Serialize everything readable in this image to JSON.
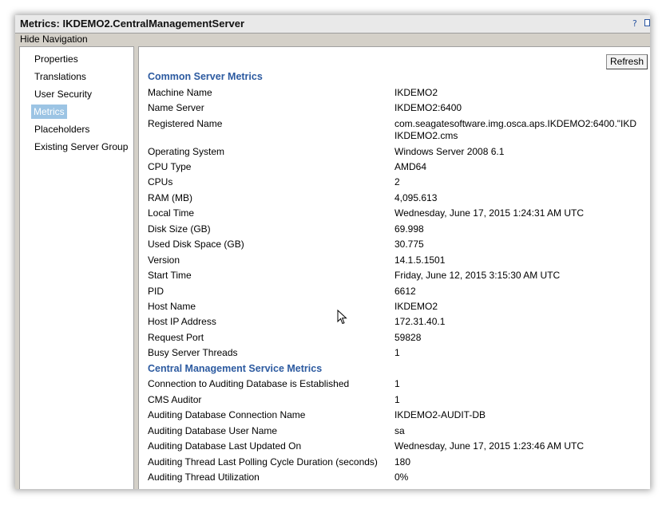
{
  "window": {
    "title": "Metrics: IKDEMO2.CentralManagementServer",
    "help_glyph": "?",
    "hide_navigation": "Hide Navigation"
  },
  "nav": {
    "items": [
      {
        "label": "Properties"
      },
      {
        "label": "Translations"
      },
      {
        "label": "User Security"
      },
      {
        "label": "Metrics",
        "selected": true
      },
      {
        "label": "Placeholders"
      },
      {
        "label": "Existing Server Group"
      }
    ]
  },
  "toolbar": {
    "refresh_label": "Refresh"
  },
  "common": {
    "title": "Common Server Metrics",
    "rows": [
      {
        "key": "Machine Name",
        "value": "IKDEMO2"
      },
      {
        "key": "Name Server",
        "value": "IKDEMO2:6400"
      },
      {
        "key": "Registered Name",
        "value": "com.seagatesoftware.img.osca.aps.IKDEMO2:6400.\"IKD",
        "value2": "IKDEMO2.cms"
      },
      {
        "key": "Operating System",
        "value": "Windows Server 2008 6.1"
      },
      {
        "key": "CPU Type",
        "value": "AMD64"
      },
      {
        "key": "CPUs",
        "value": "2"
      },
      {
        "key": "RAM (MB)",
        "value": "4,095.613"
      },
      {
        "key": "Local Time",
        "value": "Wednesday, June 17, 2015 1:24:31 AM UTC"
      },
      {
        "key": "Disk Size (GB)",
        "value": "69.998"
      },
      {
        "key": "Used Disk Space (GB)",
        "value": "30.775"
      },
      {
        "key": "Version",
        "value": "14.1.5.1501"
      },
      {
        "key": "Start Time",
        "value": "Friday, June 12, 2015 3:15:30 AM UTC"
      },
      {
        "key": "PID",
        "value": "6612"
      },
      {
        "key": "Host Name",
        "value": "IKDEMO2"
      },
      {
        "key": "Host IP Address",
        "value": "172.31.40.1"
      },
      {
        "key": "Request Port",
        "value": "59828"
      },
      {
        "key": "Busy Server Threads",
        "value": "1"
      }
    ]
  },
  "cms": {
    "title": "Central Management Service Metrics",
    "rows": [
      {
        "key": "Connection to Auditing Database is Established",
        "value": "1"
      },
      {
        "key": "CMS Auditor",
        "value": "1"
      },
      {
        "key": "Auditing Database Connection Name",
        "value": "IKDEMO2-AUDIT-DB"
      },
      {
        "key": "Auditing Database User Name",
        "value": "sa"
      },
      {
        "key": "Auditing Database Last Updated On",
        "value": "Wednesday, June 17, 2015 1:23:46 AM UTC"
      },
      {
        "key": "Auditing Thread Last Polling Cycle Duration (seconds)",
        "value": "180"
      },
      {
        "key": "Auditing Thread Utilization",
        "value": "0%"
      }
    ]
  },
  "colors": {
    "section_title": "#2c5aa0",
    "selected_nav": "#9cc4e4"
  }
}
